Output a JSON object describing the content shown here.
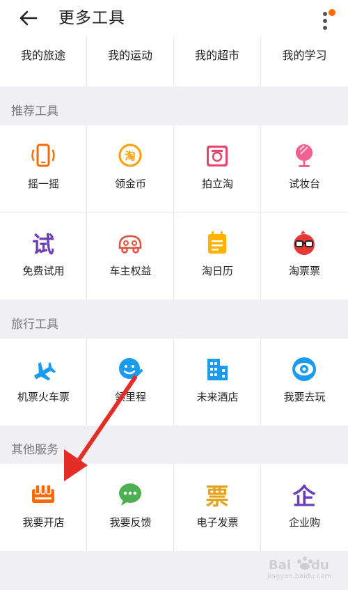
{
  "header": {
    "title": "更多工具",
    "back_icon": "arrow-left-icon",
    "menu_icon": "more-vertical-icon",
    "notification_dot_color": "#ff6a00"
  },
  "top_row": {
    "items": [
      {
        "label": "我的旅途"
      },
      {
        "label": "我的运动"
      },
      {
        "label": "我的超市"
      },
      {
        "label": "我的学习"
      }
    ]
  },
  "sections": [
    {
      "title": "推荐工具",
      "items": [
        {
          "label": "摇一摇",
          "icon": "shake-phone-icon"
        },
        {
          "label": "领金币",
          "icon": "gold-coin-icon"
        },
        {
          "label": "拍立淘",
          "icon": "camera-icon"
        },
        {
          "label": "试妆台",
          "icon": "mirror-icon"
        },
        {
          "label": "免费试用",
          "icon": "trial-icon"
        },
        {
          "label": "车主权益",
          "icon": "car-icon"
        },
        {
          "label": "淘日历",
          "icon": "calendar-icon"
        },
        {
          "label": "淘票票",
          "icon": "movie-ticket-icon"
        }
      ]
    },
    {
      "title": "旅行工具",
      "items": [
        {
          "label": "机票火车票",
          "icon": "airplane-icon"
        },
        {
          "label": "领里程",
          "icon": "mileage-icon"
        },
        {
          "label": "未来酒店",
          "icon": "hotel-icon"
        },
        {
          "label": "我要去玩",
          "icon": "eye-icon"
        }
      ]
    },
    {
      "title": "其他服务",
      "items": [
        {
          "label": "我要开店",
          "icon": "shop-icon"
        },
        {
          "label": "我要反馈",
          "icon": "feedback-icon"
        },
        {
          "label": "电子发票",
          "icon": "invoice-icon"
        },
        {
          "label": "企业购",
          "icon": "enterprise-icon"
        }
      ]
    }
  ],
  "colors": {
    "orange": "#ff6a00",
    "green": "#5cb85c",
    "blue": "#1b9bee",
    "purple": "#6a3fb7",
    "annotation_arrow": "#e52d27"
  },
  "watermark": {
    "logo": "Bai du 经验",
    "url": "jingyan.baidu.com"
  }
}
